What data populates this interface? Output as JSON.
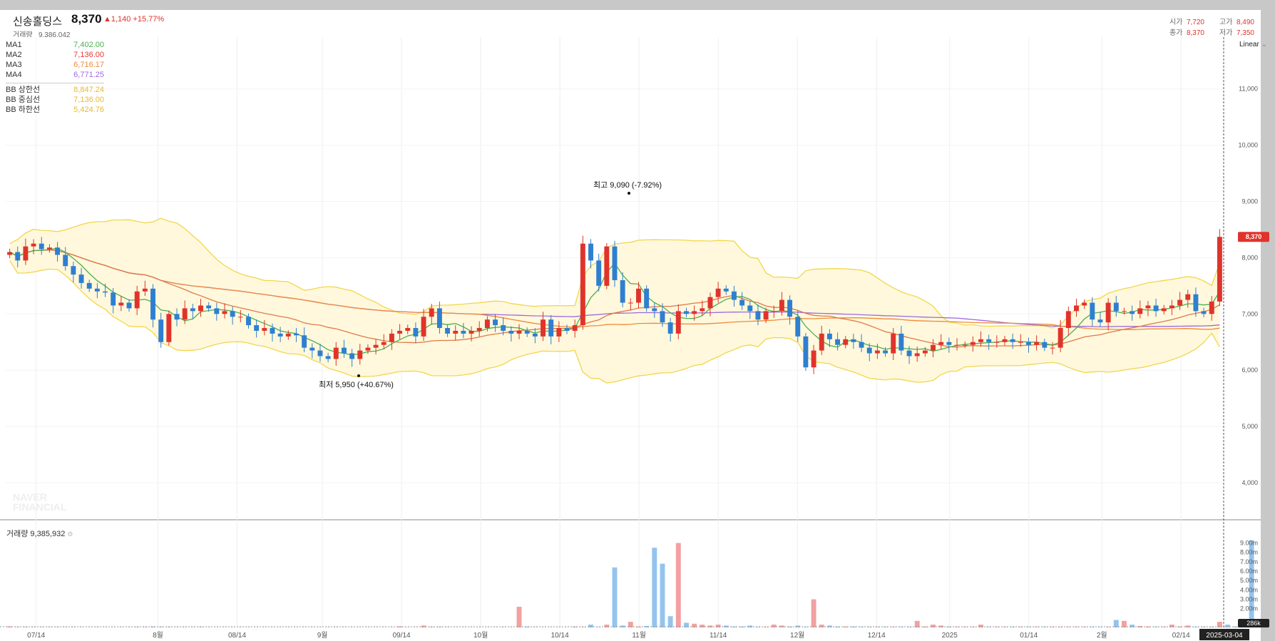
{
  "header": {
    "name": "신송홀딩스",
    "price": "8,370",
    "change": "▲1,140 +15.77%",
    "volume_label": "거래량",
    "volume": "9,386,042",
    "open_label": "시가",
    "open": "7,720",
    "high_label": "고가",
    "high": "8,490",
    "close_label": "종가",
    "close": "8,370",
    "low_label": "저가",
    "low": "7,350"
  },
  "legend": [
    {
      "name": "MA1",
      "value": "7,402.00",
      "color": "#4caf50"
    },
    {
      "name": "MA2",
      "value": "7,136.00",
      "color": "#e53935"
    },
    {
      "name": "MA3",
      "value": "6,716.17",
      "color": "#ef8a3c"
    },
    {
      "name": "MA4",
      "value": "6,771.25",
      "color": "#9c6ade"
    },
    {
      "name": "BB 상한선",
      "value": "8,847.24",
      "color": "#e8b833"
    },
    {
      "name": "BB 중심선",
      "value": "7,136.00",
      "color": "#e8b833"
    },
    {
      "name": "BB 하한선",
      "value": "5,424.76",
      "color": "#e8b833"
    }
  ],
  "scale_mode": "Linear",
  "volume_panel_title": "거래량 9,385,932",
  "watermark": [
    "NAVER",
    "FINANCIAL"
  ],
  "colors": {
    "up": "#e0332b",
    "down": "#2f7fd0",
    "band": "#fff8dc",
    "band_line": "#f2d64b"
  },
  "chart_data": {
    "type": "candlestick",
    "ylim": [
      3500,
      11500
    ],
    "y_ticks": [
      "4,000",
      "5,000",
      "6,000",
      "7,000",
      "8,000",
      "9,000",
      "10,000",
      "11,000"
    ],
    "x_ticks": [
      "07/14",
      "8월",
      "08/14",
      "9월",
      "09/14",
      "10월",
      "10/14",
      "11월",
      "11/14",
      "12월",
      "12/14",
      "2025",
      "01/14",
      "2월",
      "02/14"
    ],
    "last_date": "2025-03-04",
    "last_price_label": "8,370",
    "high_annotation": "최고 9,090 (-7.92%)",
    "low_annotation": "최저 5,950 (+40.67%)",
    "volume_ticks": [
      "2.00m",
      "3.00m",
      "4.00m",
      "5.00m",
      "6.00m",
      "7.00m",
      "8.00m",
      "9.00m"
    ],
    "volume_last_label": "286k",
    "close": [
      8100,
      7950,
      8200,
      8250,
      8150,
      8180,
      8050,
      7850,
      7700,
      7550,
      7450,
      7400,
      7380,
      7150,
      7200,
      7100,
      7400,
      7450,
      6900,
      6500,
      7000,
      6900,
      7100,
      7050,
      7150,
      7100,
      7000,
      7050,
      6950,
      6950,
      6800,
      6700,
      6750,
      6650,
      6600,
      6650,
      6620,
      6400,
      6350,
      6250,
      6200,
      6400,
      6300,
      6200,
      6350,
      6400,
      6450,
      6500,
      6650,
      6700,
      6750,
      6600,
      6950,
      7100,
      6750,
      6650,
      6700,
      6650,
      6700,
      6750,
      6900,
      6800,
      6700,
      6650,
      6700,
      6650,
      6600,
      6900,
      6600,
      6750,
      6700,
      6800,
      8250,
      7950,
      7500,
      8200,
      7600,
      7200,
      7200,
      7450,
      7100,
      7050,
      6850,
      6650,
      7050,
      7000,
      7050,
      7100,
      7300,
      7450,
      7400,
      7250,
      7150,
      7050,
      6900,
      7050,
      7050,
      7250,
      6950,
      6600,
      6050,
      6350,
      6650,
      6550,
      6450,
      6550,
      6500,
      6400,
      6300,
      6350,
      6300,
      6650,
      6350,
      6250,
      6300,
      6350,
      6450,
      6500,
      6450,
      6450,
      6450,
      6500,
      6550,
      6500,
      6500,
      6550,
      6500,
      6500,
      6450,
      6500,
      6400,
      6400,
      6750,
      7050,
      7150,
      7200,
      6900,
      6850,
      7200,
      7050,
      7050,
      7000,
      7100,
      7150,
      7050,
      7100,
      7150,
      7250,
      7350,
      7050,
      7000,
      7220,
      8370
    ],
    "volume_m": [
      0.12,
      0.04,
      0.05,
      0.03,
      0.03,
      0.03,
      0.03,
      0.03,
      0.03,
      0.02,
      0.02,
      0.03,
      0.02,
      0.02,
      0.02,
      0.02,
      0.05,
      0.04,
      0.1,
      0.05,
      0.04,
      0.03,
      0.03,
      0.03,
      0.04,
      0.02,
      0.02,
      0.02,
      0.02,
      0.02,
      0.02,
      0.02,
      0.02,
      0.02,
      0.02,
      0.02,
      0.02,
      0.02,
      0.02,
      0.02,
      0.02,
      0.03,
      0.02,
      0.02,
      0.02,
      0.02,
      0.02,
      0.02,
      0.02,
      0.12,
      0.02,
      0.02,
      0.2,
      0.05,
      0.06,
      0.03,
      0.02,
      0.02,
      0.02,
      0.02,
      0.02,
      0.02,
      0.03,
      0.02,
      2.2,
      0.1,
      0.03,
      0.02,
      0.02,
      0.02,
      0.02,
      0.08,
      0.04,
      0.3,
      0.03,
      0.3,
      6.4,
      0.2,
      0.6,
      0.1,
      0.15,
      8.5,
      6.8,
      1.2,
      9.0,
      0.5,
      0.4,
      0.3,
      0.2,
      0.3,
      0.2,
      0.1,
      0.1,
      0.2,
      0.05,
      0.05,
      0.3,
      0.2,
      0.1,
      0.2,
      0.05,
      3.0,
      0.3,
      0.2,
      0.1,
      0.1,
      0.1,
      0.05,
      0.05,
      0.05,
      0.05,
      0.05,
      0.05,
      0.05,
      0.7,
      0.1,
      0.3,
      0.2,
      0.1,
      0.05,
      0.05,
      0.05,
      0.3,
      0.05,
      0.05,
      0.05,
      0.05,
      0.05,
      0.05,
      0.05,
      0.05,
      0.05,
      0.05,
      0.05,
      0.05,
      0.05,
      0.05,
      0.05,
      0.05,
      0.8,
      0.7,
      0.3,
      0.15,
      0.1,
      0.05,
      0.05,
      0.3,
      0.1,
      0.2,
      0.05,
      0.05,
      0.05,
      0.6,
      0.3,
      0.1,
      0.3,
      9.3
    ]
  }
}
